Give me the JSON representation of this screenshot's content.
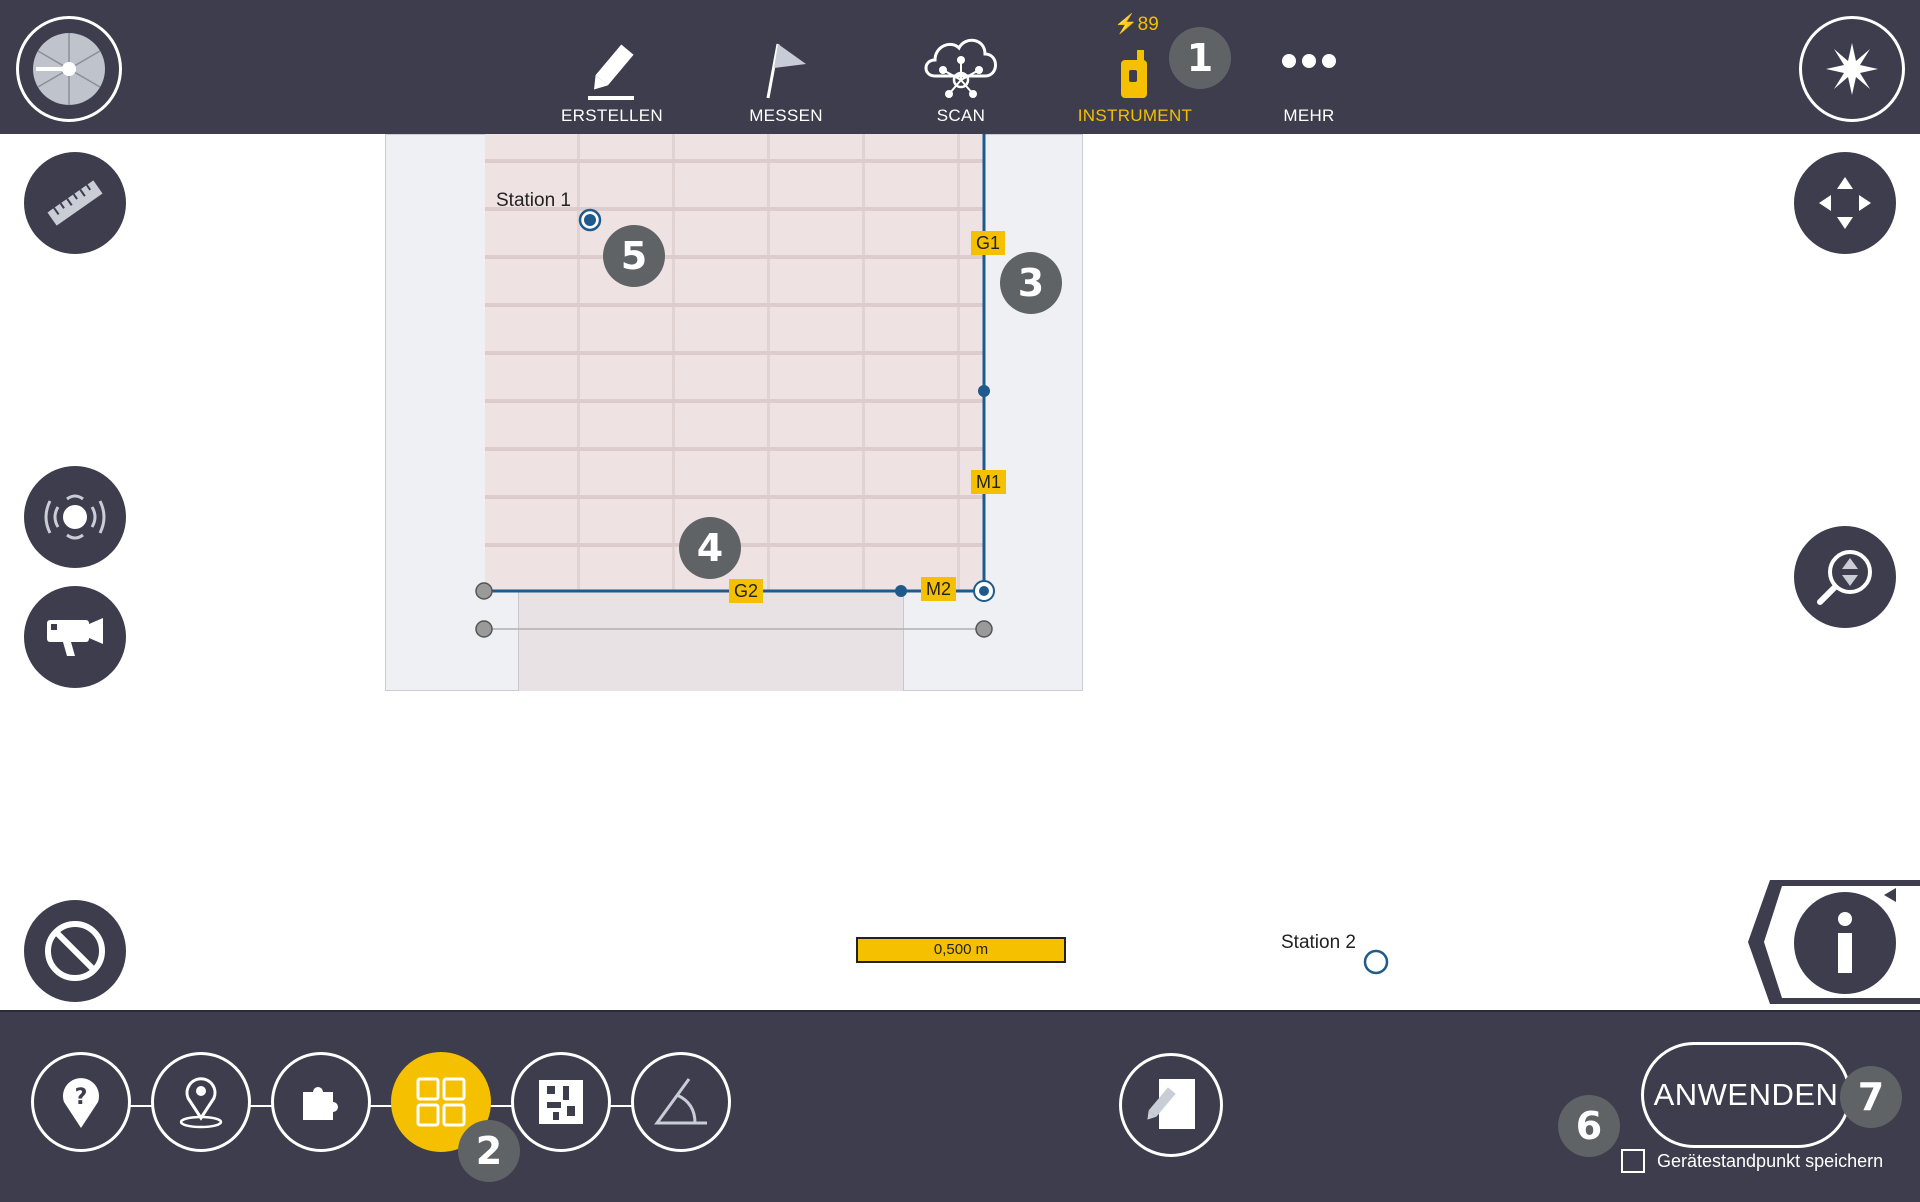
{
  "toolbar": {
    "tabs": [
      {
        "label": "ERSTELLEN",
        "icon": "pencil-icon",
        "active": false
      },
      {
        "label": "MESSEN",
        "icon": "flag-icon",
        "active": false
      },
      {
        "label": "SCAN",
        "icon": "cloud-network-icon",
        "active": false
      },
      {
        "label": "INSTRUMENT",
        "icon": "instrument-icon",
        "active": true
      },
      {
        "label": "MEHR",
        "icon": "more-dots-icon",
        "active": false
      }
    ],
    "battery": "89"
  },
  "plan": {
    "station1": "Station 1",
    "station2": "Station 2",
    "tags": {
      "g1": "G1",
      "m1": "M1",
      "g2": "G2",
      "m2": "M2"
    },
    "scale": "0,500 m"
  },
  "markers": {
    "m1": "1",
    "m2": "2",
    "m3": "3",
    "m4": "4",
    "m5": "5",
    "m6": "6",
    "m7": "7"
  },
  "footer": {
    "apply_label": "ANWENDEN",
    "save_station_label": "Gerätestandpunkt speichern",
    "save_station_checked": false
  },
  "colors": {
    "accent": "#f5c000",
    "bar": "#3d3d4d",
    "line": "#1f5a8c",
    "marker": "#5f6366"
  }
}
